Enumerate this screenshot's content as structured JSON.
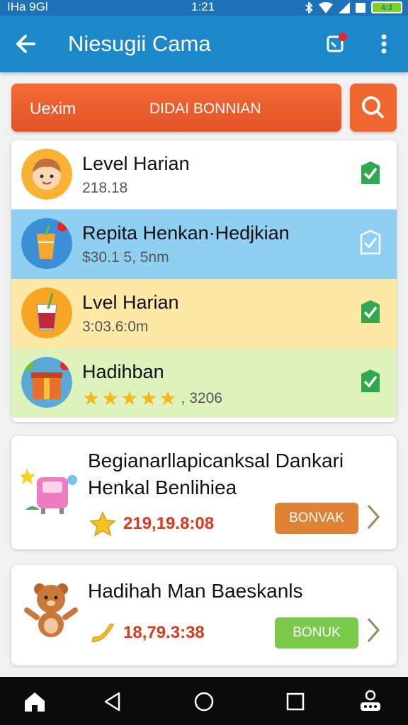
{
  "status_bar": {
    "left_text": "IHa 9Gl",
    "time": "1:21",
    "battery": "4:3"
  },
  "app_bar": {
    "title": "Niesugii Cama"
  },
  "banner": {
    "left_label": "Uexim",
    "center_label": "DIDAI BONNIAN"
  },
  "tasks": [
    {
      "title": "Level Harian",
      "subtitle": "218.18",
      "background": "#ffffff",
      "icon": "girl-face-icon",
      "checked": true
    },
    {
      "title": "Repita Henkan·Hedjkian",
      "subtitle": "$30.1 5, 5nm",
      "background": "#8fd0f2",
      "icon": "juice-cup-icon",
      "checked": false
    },
    {
      "title": "Lvel Harian",
      "subtitle": "3:03.6:0m",
      "background": "#fde8a6",
      "icon": "drink-glass-icon",
      "checked": true
    },
    {
      "title": "Hadihban",
      "rating_stars": 5,
      "subtitle": ", 3206",
      "background": "#def2bb",
      "icon": "gift-box-icon",
      "checked": true
    }
  ],
  "rewards": [
    {
      "title_line1": "Begianarllapicanksal Dankari",
      "title_line2": "Henkal Benlihiea",
      "amount": "219,19.8:08",
      "button_label": "BONVAK",
      "button_color": "#e08236",
      "icon": "toy-machine-icon",
      "coin_icon": "star-coin-icon"
    },
    {
      "title_line1": "Hadihah Man Baeskanls",
      "amount": "18,79.3:38",
      "button_label": "BONUK",
      "button_color": "#7bc94a",
      "icon": "teddy-bear-icon",
      "coin_icon": "banana-icon"
    }
  ],
  "colors": {
    "app_bar": "#1c88c9",
    "status_bar": "#1e73b8",
    "banner": "#f0662f",
    "check_green": "#2fa84f",
    "amount_red": "#d93a1e"
  }
}
